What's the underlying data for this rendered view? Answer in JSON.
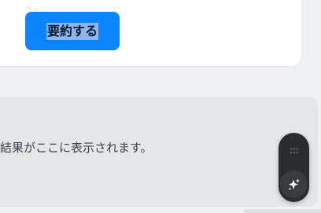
{
  "summary_card": {
    "summarize_label": "要約する"
  },
  "result": {
    "placeholder_text": "結果がここに表示されます。"
  },
  "widget": {
    "drag_icon": "drag-handle-icon",
    "action_icon": "sparkle-icon"
  },
  "colors": {
    "accent": "#0a84ff",
    "widget_bg": "#2a2c30"
  }
}
